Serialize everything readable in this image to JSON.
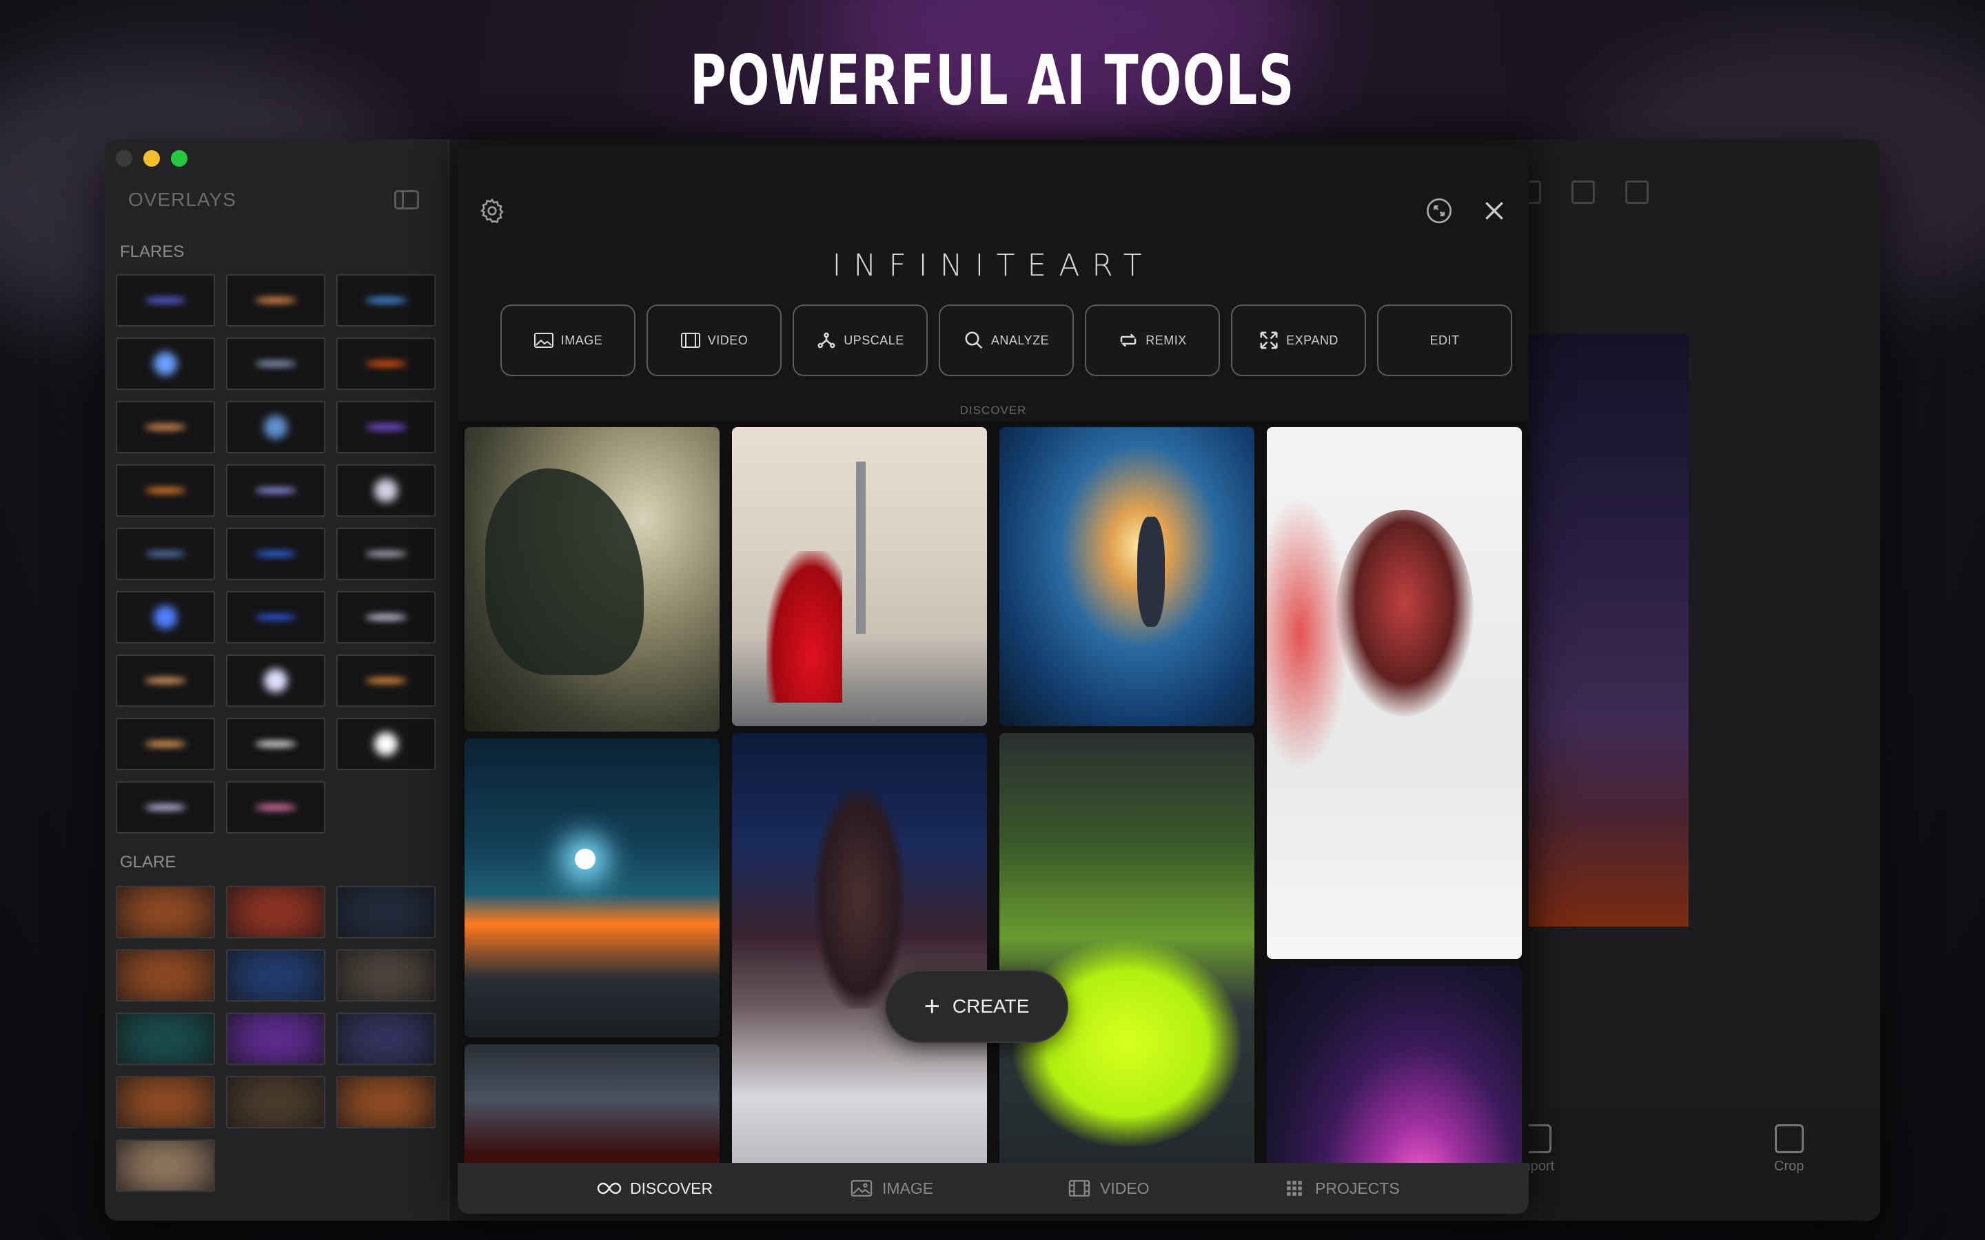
{
  "headline": "POWERFUL AI TOOLS",
  "sidebar": {
    "title": "OVERLAYS",
    "flares_label": "FLARES",
    "glare_label": "GLARE",
    "flares": [
      "#6a6aff",
      "#ff9a50",
      "#4aa0ff",
      "#6aa0ff",
      "#9ab0d0",
      "#ff5a10",
      "#ffa060",
      "#6090d0",
      "#8a5aff",
      "#ff8a30",
      "#a0a0ff",
      "#d0d0e0",
      "#6080c0",
      "#3070ff",
      "#c0c0d0",
      "#5080ff",
      "#3060ff",
      "#e0e0ff",
      "#ffb070",
      "#e0e0ff",
      "#ff9a40",
      "#ffb060",
      "#ffffff",
      "#ffffff",
      "#e0d0ff",
      "#ff80c0"
    ],
    "glares": [
      "#ff7a30",
      "#ff5030",
      "#304060",
      "#ff7a30",
      "#3060c0",
      "#807060",
      "#208080",
      "#a040ff",
      "#5050a0",
      "#ff8030",
      "#806040",
      "#ff8030",
      "#ffd0a0"
    ]
  },
  "right_panel": {
    "import_label": "mport",
    "crop_label": "Crop"
  },
  "modal": {
    "logo": "INFINITEART",
    "tools": [
      {
        "label": "IMAGE",
        "icon": "image-icon"
      },
      {
        "label": "VIDEO",
        "icon": "film-icon"
      },
      {
        "label": "UPSCALE",
        "icon": "upscale-icon"
      },
      {
        "label": "ANALYZE",
        "icon": "magnifier-icon"
      },
      {
        "label": "REMIX",
        "icon": "remix-icon"
      },
      {
        "label": "EXPAND",
        "icon": "expand-icon"
      },
      {
        "label": "EDIT",
        "icon": ""
      }
    ],
    "discover_label": "DISCOVER",
    "create_label": "CREATE",
    "nav": [
      {
        "label": "DISCOVER",
        "icon": "infinity-icon"
      },
      {
        "label": "IMAGE",
        "icon": "image-icon"
      },
      {
        "label": "VIDEO",
        "icon": "film-icon"
      },
      {
        "label": "PROJECTS",
        "icon": "grid-icon"
      }
    ]
  }
}
